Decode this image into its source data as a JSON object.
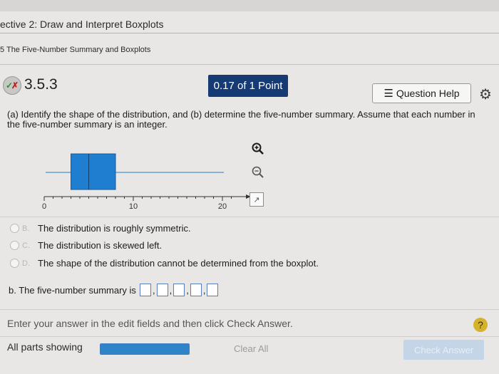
{
  "header": {
    "objective_title": "ective 2: Draw and Interpret Boxplots",
    "section_title": "5 The Five-Number Summary and Boxplots"
  },
  "question": {
    "number": "3.5.3",
    "points": "0.17 of 1 Point",
    "help_label": "Question Help",
    "prompt_line1": "(a) Identify the shape of the distribution, and (b) determine the five-number summary. Assume that each number in",
    "prompt_line2": "the five-number summary is an integer."
  },
  "chart_data": {
    "type": "boxplot",
    "axis_ticks": [
      "0",
      "10",
      "20"
    ],
    "xlim": [
      0,
      21
    ],
    "min": 0,
    "q1": 3,
    "median": 5,
    "q3": 8,
    "max": 20,
    "color": "#1f7ed0"
  },
  "options": [
    {
      "letter": "B.",
      "text": "The distribution is roughly symmetric."
    },
    {
      "letter": "C.",
      "text": "The distribution is skewed left."
    },
    {
      "letter": "D.",
      "text": "The shape of the distribution cannot be determined from the boxplot."
    }
  ],
  "part_b": {
    "label": "b. The five-number summary is",
    "separator": ","
  },
  "footer": {
    "instruction": "Enter your answer in the edit fields and then click Check Answer.",
    "parts_label": "All parts showing",
    "progress_fraction": 1.0,
    "clear_label": "Clear All",
    "check_label": "Check Answer",
    "help_symbol": "?"
  },
  "icons": {
    "zoom_in": "zoom-in-icon",
    "zoom_out": "zoom-out-icon",
    "popout": "popout-icon",
    "gear": "gear-icon",
    "menu_lines": "menu-lines-icon"
  }
}
